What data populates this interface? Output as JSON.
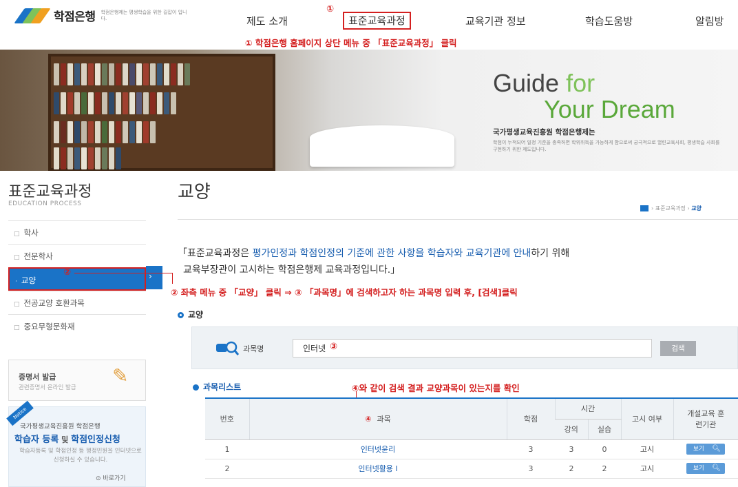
{
  "header": {
    "logo_name": "학점은행",
    "logo_tag": "학점은행제는 평생학습을 위한 길잡이 입니다.",
    "nav": [
      "제도 소개",
      "표준교육과정",
      "교육기관 정보",
      "학습도움방",
      "알림방"
    ],
    "colors": {
      "accent": "#1a73c7",
      "annotation": "#d42020"
    }
  },
  "annotations": {
    "n1": "①",
    "step1": "① 학점은행 홈페이지 상단 메뉴 중 「표준교육과정」 클릭",
    "n2": "②",
    "step2": "② 좌측 메뉴 중 「교양」 클릭 ⇒ ③ 「과목명」에 검색하고자 하는 과목명 입력 후, [검색]클릭",
    "n3": "③",
    "step4": "④와 같이 검색 결과 교양과목이 있는지를 확인",
    "n4": "④"
  },
  "banner": {
    "title_a": "Guide ",
    "title_b": "for",
    "title_c": "Your Dream",
    "k1": "국가평생교육진흥원 학점은행제는",
    "k2": "학점이 누적되어 일정 기준을 충족하면 학위취득을 가능하게 함으로써 궁극적으로 열린교육사회, 평생학습 사회를 구현하기 위한 제도입니다."
  },
  "sidebar": {
    "title": "표준교육과정",
    "subtitle": "EDUCATION PROCESS",
    "items": [
      {
        "label": "학사"
      },
      {
        "label": "전문학사"
      },
      {
        "label": "교양"
      },
      {
        "label": "전공교양 호환과목"
      },
      {
        "label": "중요무형문화재"
      }
    ],
    "cert": {
      "title": "증명서 발급",
      "sub": "관련증명서 온라인 발급"
    },
    "notice": {
      "tag": "Notice",
      "line1": "국가평생교육진흥원 학점은행",
      "line2a": "학습자 등록",
      "line2b": " 및 ",
      "line2c": "학점인정신청",
      "line3": "학습자등록 및 학점인정 등 행정민원을 인터넷으로 신청하실 수 있습니다.",
      "link": "바로가기"
    }
  },
  "main": {
    "title": "교양",
    "breadcrumb": [
      "표준교육과정",
      "교양"
    ],
    "intro_a": "「표준교육과정은 ",
    "intro_b": "평가인정과 학점인정의 기준에 관한 사항을 학습자와 교육기관에 안내",
    "intro_c": "하기 위해",
    "intro_d": "교육부장관이 고시하는 학점은행제 교육과정입니다.」",
    "section": "교양",
    "search": {
      "label": "과목명",
      "value": "인터넷",
      "button": "검색"
    },
    "list_title": "과목리스트",
    "table": {
      "headers": {
        "no": "번호",
        "subject": "과목",
        "credit": "학점",
        "time": "시간",
        "lecture": "강의",
        "practice": "실습",
        "exam": "고시 여부",
        "org": "개설교육 훈련기관"
      },
      "rows": [
        {
          "no": "1",
          "subject": "인터넷윤리",
          "credit": "3",
          "lecture": "3",
          "practice": "0",
          "exam": "고시",
          "btn": "보기"
        },
        {
          "no": "2",
          "subject": "인터넷활용 I",
          "credit": "3",
          "lecture": "2",
          "practice": "2",
          "exam": "고시",
          "btn": "보기"
        }
      ]
    }
  }
}
